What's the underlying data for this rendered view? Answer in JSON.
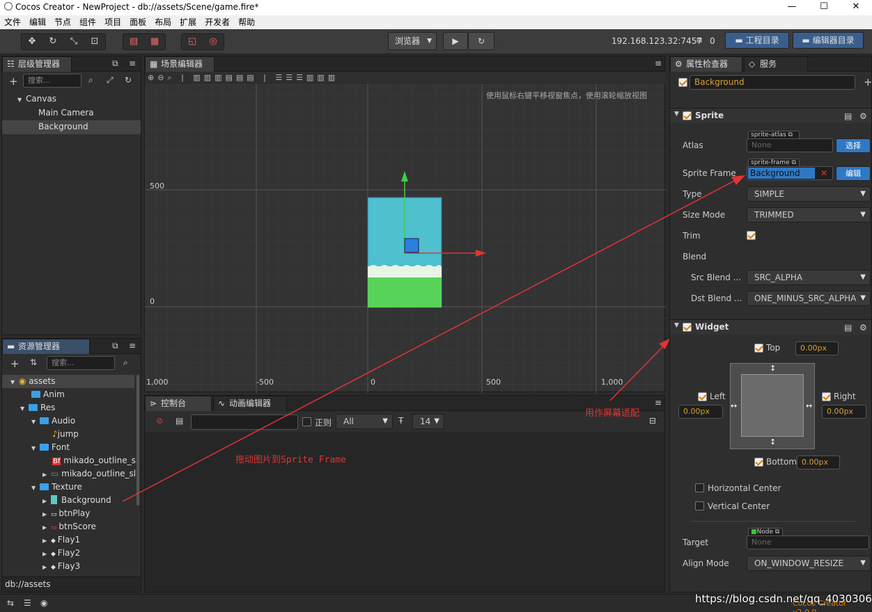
{
  "window": {
    "title": "Cocos Creator - NewProject - db://assets/Scene/game.fire*"
  },
  "menu": [
    "文件",
    "编辑",
    "节点",
    "组件",
    "项目",
    "面板",
    "布局",
    "扩展",
    "开发者",
    "帮助"
  ],
  "toolbar": {
    "browser": "浏览器",
    "ip": "192.168.123.32:7457",
    "wifi_count": "0",
    "project_dir": "工程目录",
    "editor_dir": "编辑器目录"
  },
  "hierarchy": {
    "title": "层级管理器",
    "search_placeholder": "搜索...",
    "items": [
      "Canvas",
      "Main Camera",
      "Background"
    ]
  },
  "scene": {
    "title": "场景编辑器",
    "hint": "使用鼠标右键平移视窗焦点，使用滚轮缩放视图",
    "y_labels": [
      "500",
      "0"
    ],
    "x_labels": [
      "1,000",
      "-500",
      "0",
      "500",
      "1,000"
    ]
  },
  "assets": {
    "title": "资源管理器",
    "search_placeholder": "搜索...",
    "footer": "db://assets",
    "items": [
      "assets",
      "Anim",
      "Res",
      "Audio",
      "jump",
      "Font",
      "mikado_outline_sl",
      "mikado_outline_sl",
      "Texture",
      "Background",
      "btnPlay",
      "btnScore",
      "Flay1",
      "Flay2",
      "Flay3"
    ]
  },
  "console": {
    "tab1": "控制台",
    "tab2": "动画编辑器",
    "regex": "正则",
    "level": "All",
    "font_size": "14"
  },
  "inspector": {
    "tab1": "属性检查器",
    "tab2": "服务",
    "node_name": "Background",
    "sprite": {
      "title": "Sprite",
      "atlas_label": "Atlas",
      "atlas_tag": "sprite-atlas",
      "atlas_value": "None",
      "atlas_btn": "选择",
      "frame_label": "Sprite Frame",
      "frame_tag": "sprite-frame",
      "frame_value": "Background",
      "frame_btn": "编辑",
      "type_label": "Type",
      "type_value": "SIMPLE",
      "size_label": "Size Mode",
      "size_value": "TRIMMED",
      "trim_label": "Trim",
      "blend_label": "Blend",
      "src_label": "Src Blend ...",
      "src_value": "SRC_ALPHA",
      "dst_label": "Dst Blend ...",
      "dst_value": "ONE_MINUS_SRC_ALPHA"
    },
    "widget": {
      "title": "Widget",
      "top": "Top",
      "top_val": "0.00px",
      "left": "Left",
      "left_val": "0.00px",
      "right": "Right",
      "right_val": "0.00px",
      "bottom": "Bottom",
      "bottom_val": "0.00px",
      "hcenter": "Horizontal Center",
      "vcenter": "Vertical Center",
      "target_label": "Target",
      "target_tag": "Node",
      "target_value": "None",
      "align_label": "Align Mode",
      "align_value": "ON_WINDOW_RESIZE"
    }
  },
  "annotations": {
    "drag": "拖动图片到Sprite Frame",
    "adapt": "用作屏幕适配"
  },
  "watermark": "https://blog.csdn.net/qq_40303068",
  "version": "Cocos Creator v2.0.9"
}
